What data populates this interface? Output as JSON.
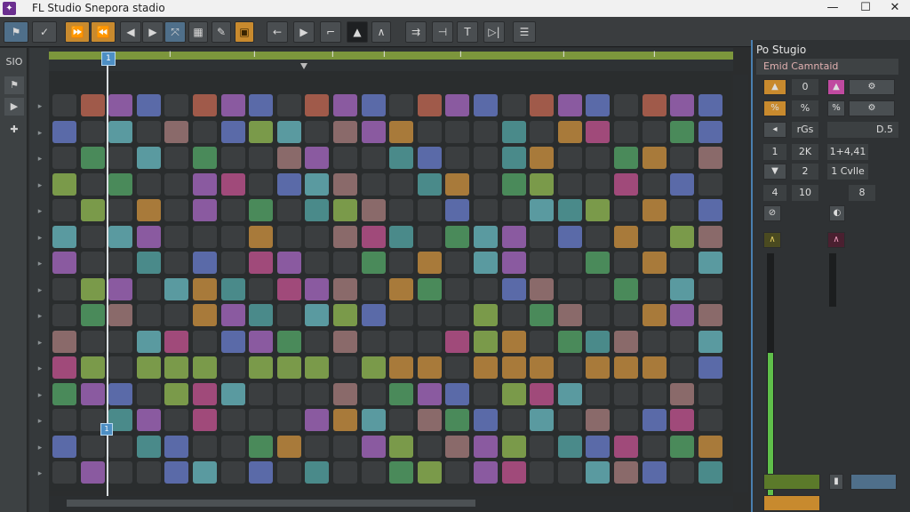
{
  "window": {
    "logo": "✦",
    "title": "FL Studio  Snepora stadio",
    "minimize": "—",
    "maximize": "☐",
    "close": "✕"
  },
  "toolbar": {
    "buttons": [
      {
        "name": "pattern-icon",
        "glyph": "⚑"
      },
      {
        "name": "draw-tool-icon",
        "glyph": "✓"
      },
      {
        "name": "fast-forward-icon",
        "glyph": "⏩"
      },
      {
        "name": "rewind-icon",
        "glyph": "⏪"
      },
      {
        "name": "previous-icon",
        "glyph": "◀"
      },
      {
        "name": "next-icon",
        "glyph": "▶"
      },
      {
        "name": "shuffle-icon",
        "glyph": "⤧"
      },
      {
        "name": "chord-icon",
        "glyph": "▦"
      },
      {
        "name": "brush-icon",
        "glyph": "✎"
      },
      {
        "name": "snap-icon",
        "glyph": "▣"
      },
      {
        "name": "arrow-left-icon",
        "glyph": "←"
      },
      {
        "name": "play-icon",
        "glyph": "▶"
      },
      {
        "name": "marker-icon",
        "glyph": "⌐"
      },
      {
        "name": "metronome-icon",
        "glyph": "▲"
      },
      {
        "name": "record-icon",
        "glyph": "∧"
      },
      {
        "name": "loop-icon",
        "glyph": "⇉"
      },
      {
        "name": "split-icon",
        "glyph": "⊣"
      },
      {
        "name": "text-icon",
        "glyph": "T"
      },
      {
        "name": "step-icon",
        "glyph": "▷|"
      },
      {
        "name": "menu-icon",
        "glyph": "☰"
      }
    ]
  },
  "left_strip": {
    "label": "SIO",
    "items": [
      "⚑",
      "▶",
      "✚"
    ]
  },
  "timeline": {
    "marker": "1",
    "marks": [
      "I",
      "I",
      "I",
      "I",
      "I",
      "I",
      "I"
    ]
  },
  "right_panel": {
    "title": "Po Stugio",
    "tab": "Emid Camntaid",
    "values": {
      "v1": "0",
      "v2": "%",
      "v3": "rGs",
      "v4": "D.5",
      "v5": "2K",
      "v6": "1+4,41",
      "v7": "2",
      "v8": "1 Cvlle",
      "v9": "10",
      "v10": "8",
      "v11": "1",
      "v12": "4"
    }
  },
  "colors": {
    "accent_blue": "#4d8fc4",
    "accent_orange": "#c88a2e",
    "timeline_green": "#7c963c"
  }
}
